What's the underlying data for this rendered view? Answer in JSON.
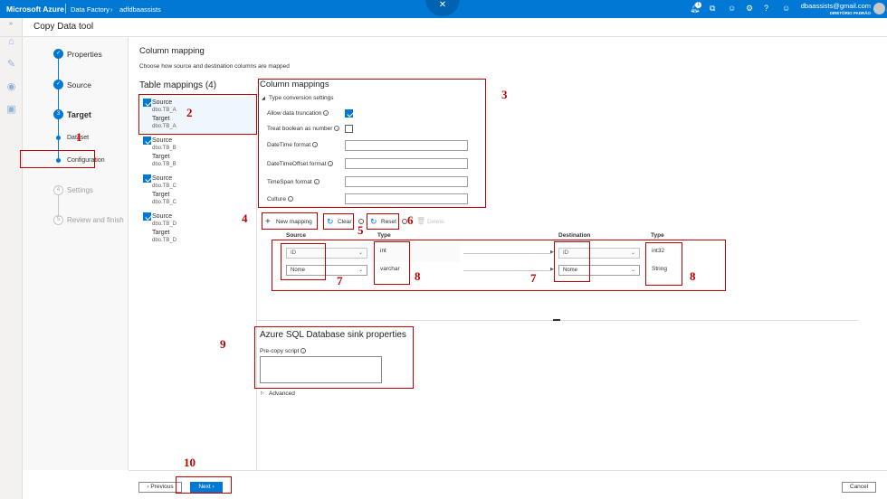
{
  "topbar": {
    "brand": "Microsoft Azure",
    "crumbs": [
      "Data Factory",
      "adfdbaassists"
    ],
    "notif_count": "1",
    "user_email": "dbaassists@gmail.com",
    "user_dir": "DIRETÓRIO PADRÃO",
    "bubble_icon": "✕"
  },
  "header": {
    "title": "Copy Data tool"
  },
  "steps": {
    "items": [
      {
        "num": "1",
        "label": "Properties",
        "state": "done"
      },
      {
        "num": "2",
        "label": "Source",
        "state": "done"
      },
      {
        "num": "3",
        "label": "Target",
        "state": "current"
      },
      {
        "label": "Dataset",
        "state": "sub"
      },
      {
        "label": "Configuration",
        "state": "sub-current"
      },
      {
        "num": "4",
        "label": "Settings",
        "state": "pending"
      },
      {
        "num": "5",
        "label": "Review and finish",
        "state": "pending"
      }
    ]
  },
  "page": {
    "title": "Column mapping",
    "subtitle": "Choose how source and destination columns are mapped"
  },
  "table_mappings": {
    "title": "Table mappings (4)",
    "items": [
      {
        "source_label": "Source",
        "source": "dbo.TB_A",
        "target_label": "Target",
        "target": "dbo.TB_A"
      },
      {
        "source_label": "Source",
        "source": "dbo.TB_B",
        "target_label": "Target",
        "target": "dbo.TB_B"
      },
      {
        "source_label": "Source",
        "source": "dbo.TB_C",
        "target_label": "Target",
        "target": "dbo.TB_C"
      },
      {
        "source_label": "Source",
        "source": "dbo.TB_D",
        "target_label": "Target",
        "target": "dbo.TB_D"
      }
    ]
  },
  "column_mappings": {
    "title": "Column mappings",
    "type_conversion": "Type conversion settings",
    "allow_truncation": "Allow data truncation",
    "allow_truncation_checked": true,
    "treat_boolean": "Treat boolean as number",
    "treat_boolean_checked": false,
    "datetime_format": "DateTime format",
    "datetimeoffset_format": "DateTimeOffset format",
    "timespan_format": "TimeSpan format",
    "culture": "Culture"
  },
  "toolbar": {
    "new_mapping": "New mapping",
    "clear": "Clear",
    "reset": "Reset",
    "delete": "Delete"
  },
  "grid": {
    "headers": {
      "source": "Source",
      "type": "Type",
      "destination": "Destination",
      "dtype": "Type"
    },
    "rows": [
      {
        "source": "ID",
        "type": "int",
        "destination": "ID",
        "dtype": "int32"
      },
      {
        "source": "Nome",
        "type": "varchar",
        "destination": "Nome",
        "dtype": "String"
      }
    ]
  },
  "sink": {
    "title": "Azure SQL Database sink properties",
    "precopy_label": "Pre-copy script",
    "advanced": "Advanced"
  },
  "footer": {
    "previous": "Previous",
    "next": "Next",
    "cancel": "Cancel"
  },
  "annotations": [
    "1",
    "2",
    "3",
    "4",
    "5",
    "6",
    "7",
    "8",
    "7",
    "8",
    "9",
    "10"
  ],
  "colors": {
    "azure_blue": "#0078d4",
    "annotation_red": "#c00000"
  }
}
